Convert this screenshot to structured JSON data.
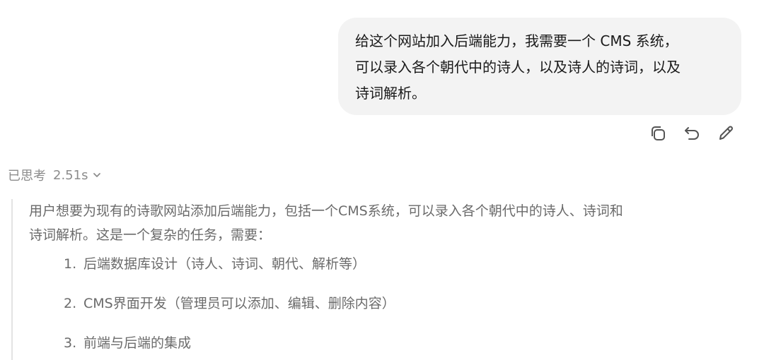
{
  "user_message": {
    "lines": [
      "给这个网站加入后端能力，我需要一个 CMS 系统，",
      "可以录入各个朝代中的诗人，以及诗人的诗词，以及",
      "诗词解析。"
    ]
  },
  "message_actions": [
    {
      "icon": "copy-icon"
    },
    {
      "icon": "retry-icon"
    },
    {
      "icon": "edit-icon"
    }
  ],
  "thinking": {
    "label": "已思考",
    "duration": "2.51s",
    "paragraph_lines": [
      "用户想要为现有的诗歌网站添加后端能力，包括一个CMS系统，可以录入各个朝代中的诗人、诗词和",
      "诗词解析。这是一个复杂的任务，需要："
    ],
    "steps": [
      {
        "num": "1.",
        "text": "后端数据库设计（诗人、诗词、朝代、解析等）"
      },
      {
        "num": "2.",
        "text": "CMS界面开发（管理员可以添加、编辑、删除内容）"
      },
      {
        "num": "3.",
        "text": "前端与后端的集成"
      }
    ]
  }
}
